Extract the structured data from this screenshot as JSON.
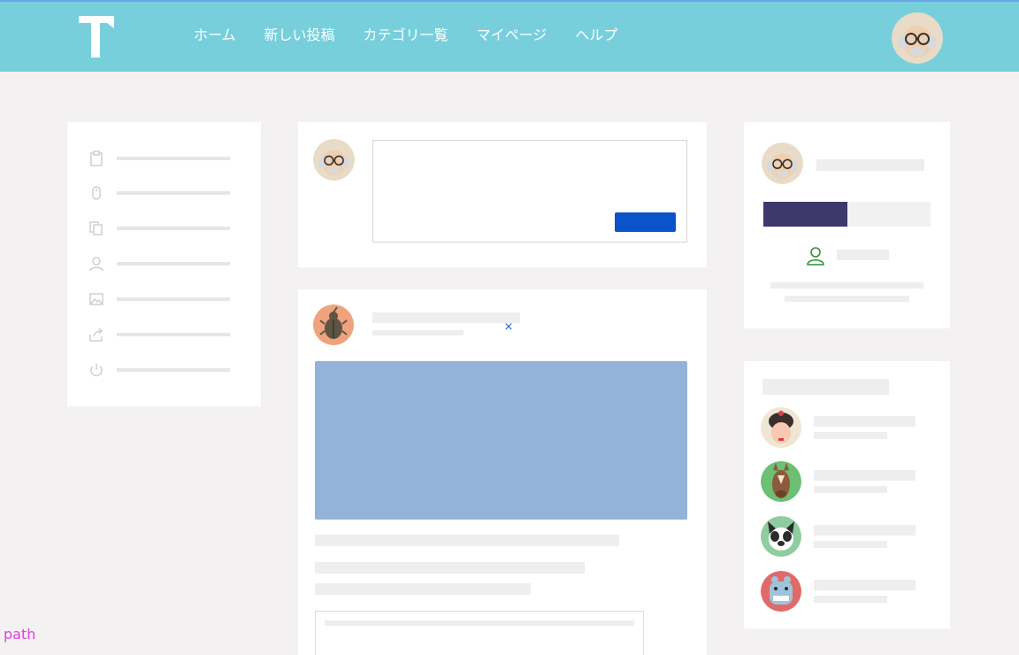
{
  "brand": {
    "logo_icon": "t-letter-logo-icon",
    "header_color": "#78cfdc"
  },
  "nav": {
    "items": [
      {
        "label": "ホーム"
      },
      {
        "label": "新しい投稿"
      },
      {
        "label": "カテゴリ一覧"
      },
      {
        "label": "マイページ"
      },
      {
        "label": "ヘルプ"
      }
    ]
  },
  "user": {
    "avatar_icon": "old-man-glasses-avatar-icon"
  },
  "side_menu": {
    "icons": [
      "clipboard-icon",
      "mouse-icon",
      "copy-icon",
      "person-icon",
      "image-icon",
      "share-icon",
      "power-icon"
    ]
  },
  "composer": {
    "post_button_color": "#0b53c8"
  },
  "feed_post": {
    "author_avatar_icon": "beetle-avatar-icon",
    "close_glyph": "×",
    "image_color": "#93b3d8"
  },
  "profile": {
    "progress_fraction": 0.5,
    "progress_color": "#3d396a"
  },
  "friends": {
    "avatars": [
      "geisha-avatar-icon",
      "horse-avatar-icon",
      "dog-avatar-icon",
      "hippo-avatar-icon"
    ]
  },
  "debug_label": "path"
}
